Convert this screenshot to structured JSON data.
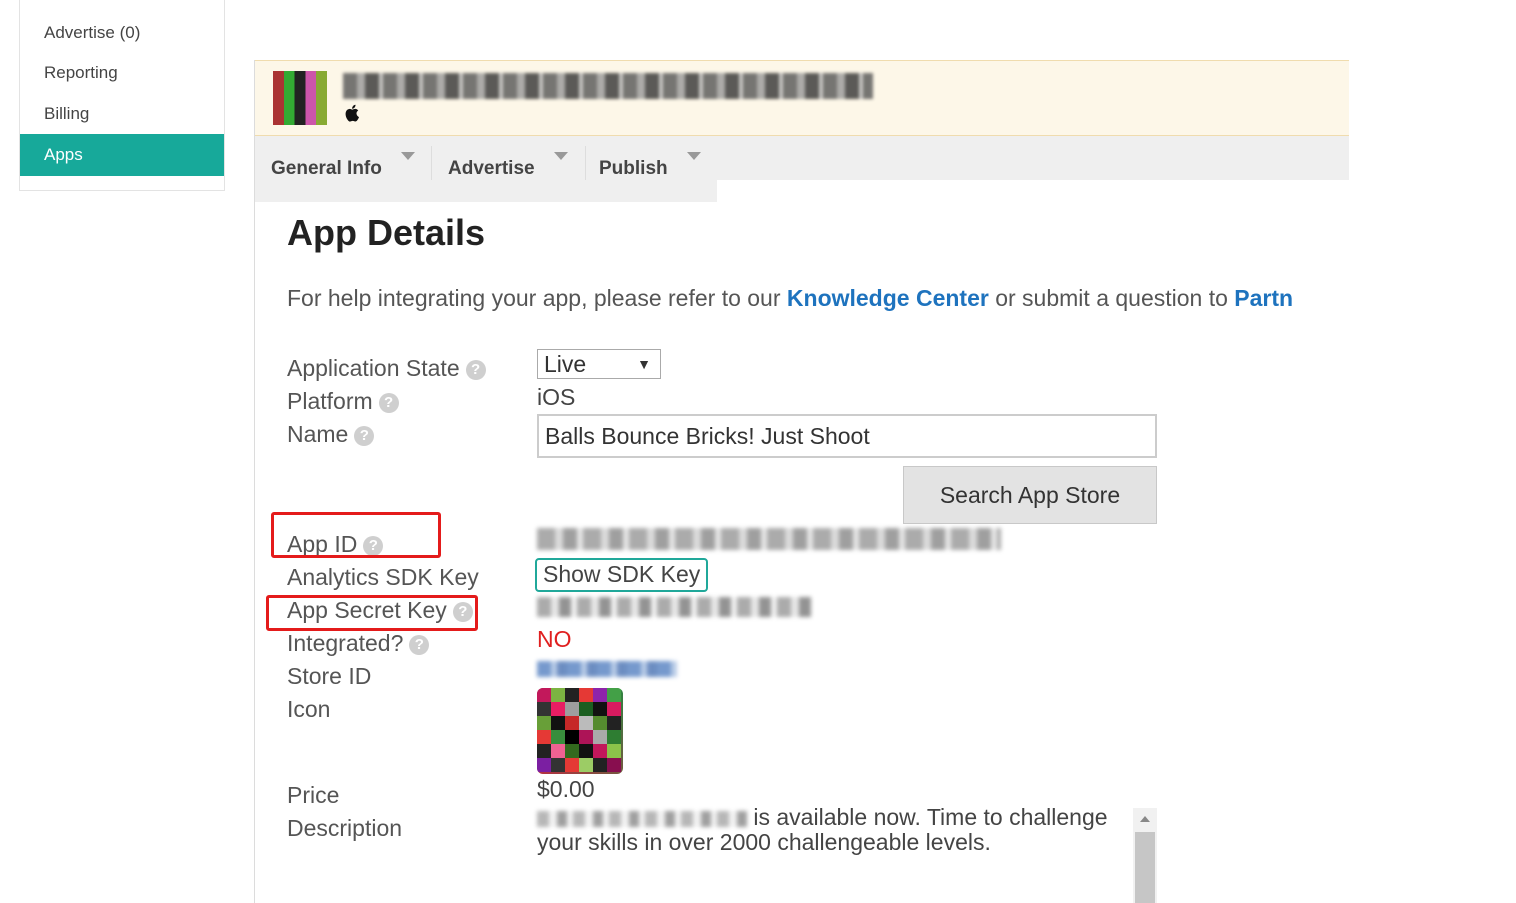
{
  "sidebar": {
    "items": [
      {
        "label": "Advertise (0)"
      },
      {
        "label": "Reporting"
      },
      {
        "label": "Billing"
      },
      {
        "label": "Apps"
      }
    ]
  },
  "tabs": [
    {
      "label": "General Info"
    },
    {
      "label": "Advertise"
    },
    {
      "label": "Publish"
    }
  ],
  "page": {
    "title": "App Details",
    "help_prefix": "For help integrating your app, please refer to our ",
    "help_link1": "Knowledge Center",
    "help_middle": " or submit a question to ",
    "help_link2": "Partn"
  },
  "fields": {
    "application_state_label": "Application State",
    "application_state_value": "Live",
    "platform_label": "Platform",
    "platform_value": "iOS",
    "name_label": "Name",
    "name_value": "Balls Bounce Bricks!  Just Shoot",
    "search_button": "Search App Store",
    "app_id_label": "App ID",
    "analytics_label": "Analytics SDK Key",
    "show_sdk_button": "Show SDK Key",
    "secret_label": "App Secret Key",
    "integrated_label": "Integrated?",
    "integrated_value": "NO",
    "store_id_label": "Store ID",
    "icon_label": "Icon",
    "price_label": "Price",
    "price_value": "$0.00",
    "description_label": "Description",
    "description_line1": "is available now. Time to challenge",
    "description_line2": "your skills in over 2000 challengeable levels."
  },
  "help_glyph": "?",
  "colors": {
    "accent": "#17a99a",
    "link": "#1e73be",
    "alert": "#e02020",
    "highlight": "#e41b1b"
  }
}
